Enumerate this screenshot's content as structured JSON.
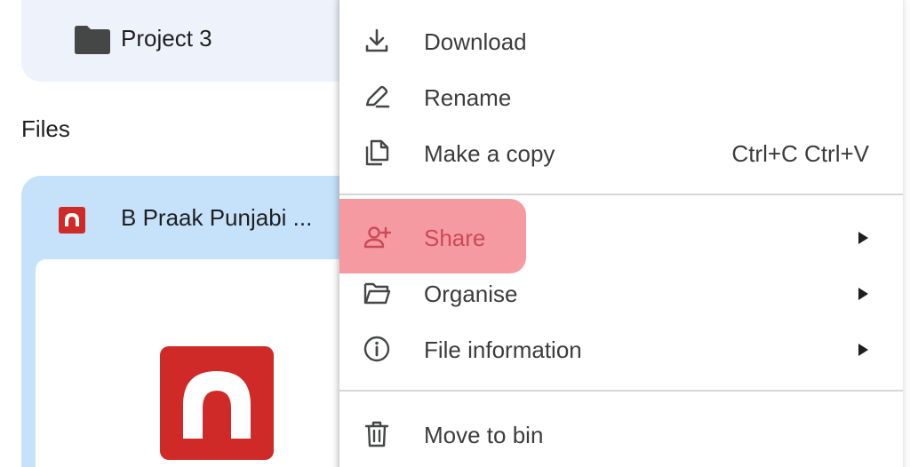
{
  "folder": {
    "name": "Project 3",
    "icon": "folder-icon"
  },
  "files_section": {
    "heading": "Files"
  },
  "file": {
    "name": "B Praak Punjabi ...",
    "icon": "audio-file-icon"
  },
  "menu": {
    "items": [
      {
        "id": "download",
        "label": "Download",
        "icon": "download-icon"
      },
      {
        "id": "rename",
        "label": "Rename",
        "icon": "rename-icon"
      },
      {
        "id": "copy",
        "label": "Make a copy",
        "icon": "copy-icon",
        "shortcut": "Ctrl+C Ctrl+V"
      },
      {
        "id": "share",
        "label": "Share",
        "icon": "person-add-icon",
        "submenu": true,
        "highlighted": true
      },
      {
        "id": "organise",
        "label": "Organise",
        "icon": "folder-open-icon",
        "submenu": true
      },
      {
        "id": "info",
        "label": "File information",
        "icon": "info-icon",
        "submenu": true
      },
      {
        "id": "bin",
        "label": "Move to bin",
        "icon": "trash-icon"
      }
    ]
  },
  "colors": {
    "folder_card_bg": "#eef2fb",
    "file_card_bg": "#c6e2fb",
    "audio_icon_red": "#cf2a27",
    "share_highlight": "#f69aa2",
    "share_text": "#c94b55"
  }
}
